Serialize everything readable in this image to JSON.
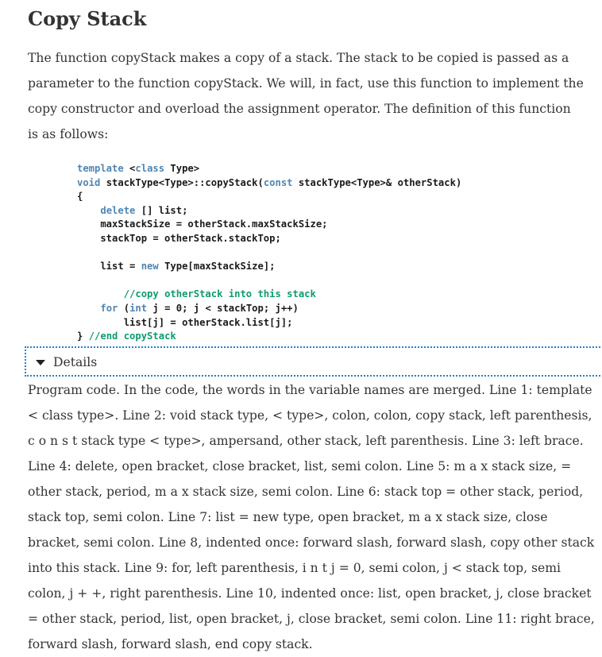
{
  "heading": "Copy Stack",
  "intro": "The function copyStack makes a copy of a stack. The stack to be copied is passed as a parameter to the function copyStack. We will, in fact, use this function to implement the copy constructor and overload the assignment operator. The definition of this function is as follows:",
  "code": {
    "lines": [
      [
        {
          "t": "template",
          "c": "kw"
        },
        {
          "t": " <",
          "c": ""
        },
        {
          "t": "class",
          "c": "kw"
        },
        {
          "t": " Type>",
          "c": ""
        }
      ],
      [
        {
          "t": "void",
          "c": "kw"
        },
        {
          "t": " stackType<Type>::copyStack(",
          "c": ""
        },
        {
          "t": "const",
          "c": "kw"
        },
        {
          "t": " stackType<Type>& otherStack)",
          "c": ""
        }
      ],
      [
        {
          "t": "{",
          "c": ""
        }
      ],
      [
        {
          "t": "    ",
          "c": ""
        },
        {
          "t": "delete",
          "c": "kw"
        },
        {
          "t": " [] list;",
          "c": ""
        }
      ],
      [
        {
          "t": "    maxStackSize = otherStack.maxStackSize;",
          "c": ""
        }
      ],
      [
        {
          "t": "    stackTop = otherStack.stackTop;",
          "c": ""
        }
      ],
      [
        {
          "t": "",
          "c": ""
        }
      ],
      [
        {
          "t": "    list = ",
          "c": ""
        },
        {
          "t": "new",
          "c": "kw"
        },
        {
          "t": " Type[maxStackSize];",
          "c": ""
        }
      ],
      [
        {
          "t": "",
          "c": ""
        }
      ],
      [
        {
          "t": "        ",
          "c": ""
        },
        {
          "t": "//copy otherStack into this stack",
          "c": "cm"
        }
      ],
      [
        {
          "t": "    ",
          "c": ""
        },
        {
          "t": "for",
          "c": "kw"
        },
        {
          "t": " (",
          "c": ""
        },
        {
          "t": "int",
          "c": "kw"
        },
        {
          "t": " j = 0; j < stackTop; j++)",
          "c": ""
        }
      ],
      [
        {
          "t": "        list[j] = otherStack.list[j];",
          "c": ""
        }
      ],
      [
        {
          "t": "} ",
          "c": ""
        },
        {
          "t": "//end copyStack",
          "c": "cm"
        }
      ]
    ]
  },
  "details": {
    "label": "Details",
    "expanded": true,
    "icon": "triangle-down-icon",
    "text": "Program code. In the code, the words in the variable names are merged. Line 1: template < class type>. Line 2: void stack type, < type>, colon, colon, copy stack, left parenthesis, c o n s t stack type < type>, ampersand, other stack, left parenthesis. Line 3: left brace. Line 4: delete, open bracket, close bracket, list, semi colon. Line 5: m a x stack size, = other stack, period, m a x stack size, semi colon. Line 6: stack top = other stack, period, stack top, semi colon. Line 7: list = new type, open bracket, m a x stack size, close bracket, semi colon. Line 8, indented once: forward slash, forward slash, copy other stack into this stack. Line 9: for, left parenthesis, i n t j = 0, semi colon, j < stack top, semi colon, j + +, right parenthesis. Line 10, indented once: list, open bracket, j, close bracket = other stack, period, list, open bracket, j, close bracket, semi colon. Line 11: right brace, forward slash, forward slash, end copy stack."
  },
  "colors": {
    "keyword": "#4f85b3",
    "comment": "#0e9b70",
    "focus_outline": "#1a7fd6",
    "text": "#333333"
  }
}
